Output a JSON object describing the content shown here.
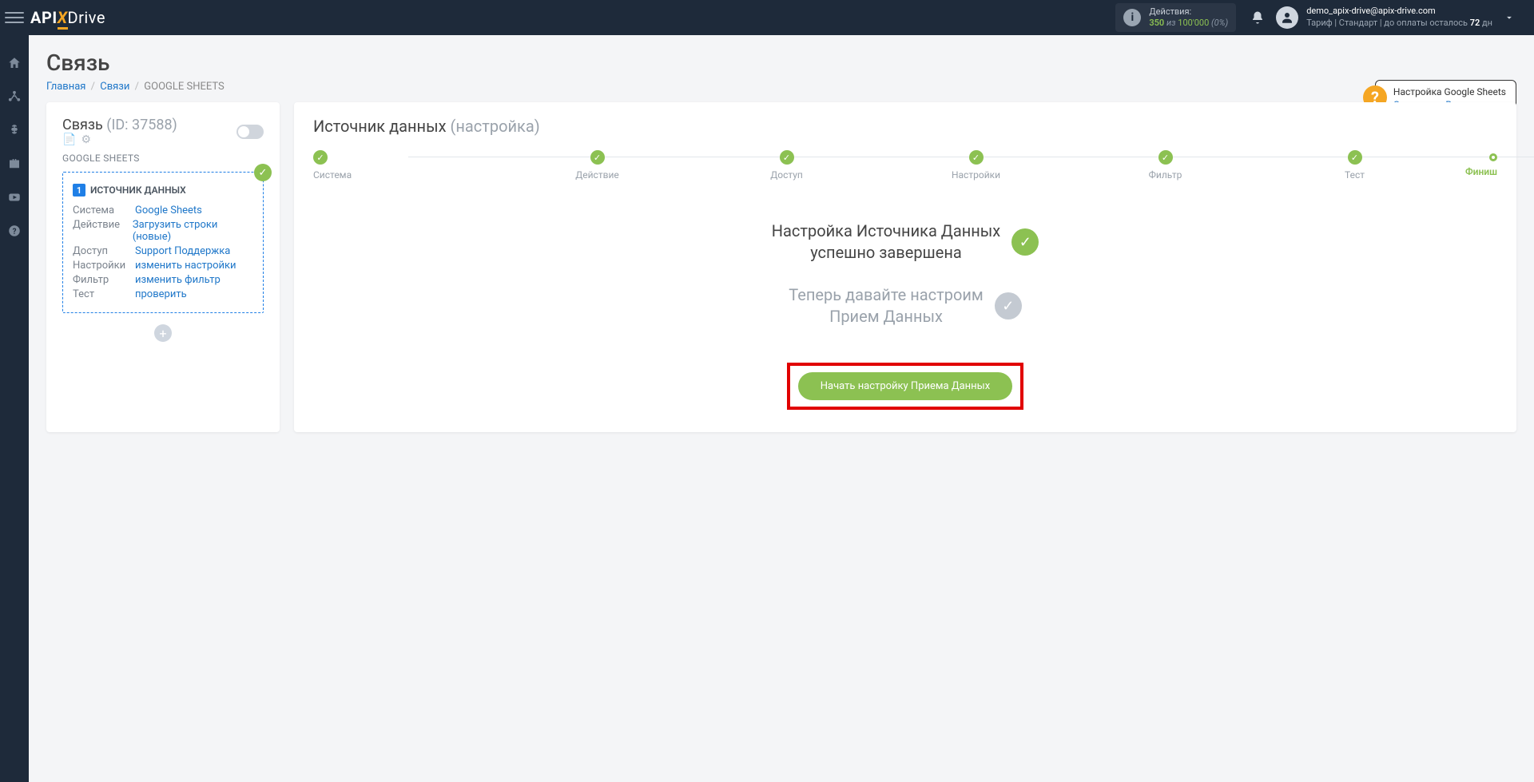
{
  "header": {
    "actions_label": "Действия:",
    "actions_used": "350",
    "actions_of": "из",
    "actions_total": "100'000",
    "actions_pct": "(0%)",
    "email": "demo_apix-drive@apix-drive.com",
    "tariff_prefix": "Тариф | Стандарт | до оплаты осталось ",
    "tariff_days": "72",
    "tariff_suffix": " дн"
  },
  "page": {
    "title": "Связь",
    "breadcrumb": {
      "home": "Главная",
      "links": "Связи",
      "current": "GOOGLE SHEETS"
    }
  },
  "help": {
    "title": "Настройка Google Sheets",
    "ref": "Справка",
    "video": "Видео"
  },
  "left": {
    "title": "Связь",
    "id_label": "(ID: 37588)",
    "subtitle": "GOOGLE SHEETS",
    "card_title": "ИСТОЧНИК ДАННЫХ",
    "rows": [
      {
        "k": "Система",
        "v": "Google Sheets"
      },
      {
        "k": "Действие",
        "v": "Загрузить строки (новые)"
      },
      {
        "k": "Доступ",
        "v": "Support Поддержка"
      },
      {
        "k": "Настройки",
        "v": "изменить настройки"
      },
      {
        "k": "Фильтр",
        "v": "изменить фильтр"
      },
      {
        "k": "Тест",
        "v": "проверить"
      }
    ]
  },
  "right": {
    "title": "Источник данных",
    "title_sub": "(настройка)",
    "steps": [
      "Система",
      "Действие",
      "Доступ",
      "Настройки",
      "Фильтр",
      "Тест",
      "Финиш"
    ],
    "done1_l1": "Настройка Источника Данных",
    "done1_l2": "успешно завершена",
    "done2_l1": "Теперь давайте настроим",
    "done2_l2": "Прием Данных",
    "button": "Начать настройку Приема Данных"
  }
}
